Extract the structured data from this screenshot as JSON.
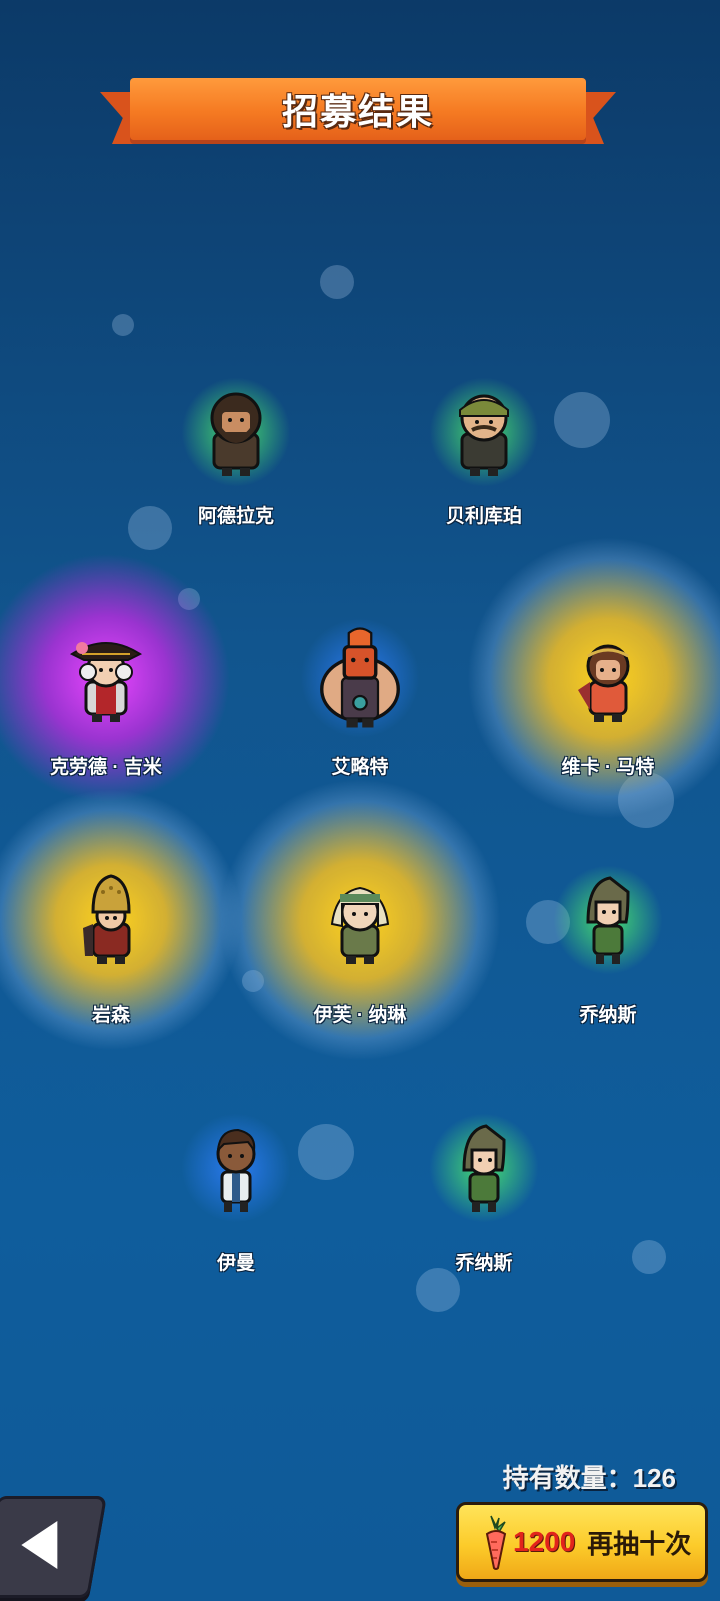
{
  "header": {
    "title": "招募结果"
  },
  "heroes": [
    {
      "name": "阿德拉克",
      "rarity_color": "#55ff66"
    },
    {
      "name": "贝利库珀",
      "rarity_color": "#55ff66"
    },
    {
      "name": "克劳德 · 吉米",
      "rarity_color": "#e040ff"
    },
    {
      "name": "艾略特",
      "rarity_color": "#2f80ff"
    },
    {
      "name": "维卡 · 马特",
      "rarity_color": "#ffc81e"
    },
    {
      "name": "岩森",
      "rarity_color": "#ffc81e"
    },
    {
      "name": "伊芙 · 纳琳",
      "rarity_color": "#ffc81e"
    },
    {
      "name": "乔纳斯",
      "rarity_color": "#55ff66"
    },
    {
      "name": "伊曼",
      "rarity_color": "#2f80ff"
    },
    {
      "name": "乔纳斯",
      "rarity_color": "#55ff66"
    }
  ],
  "footer": {
    "holding_label": "持有数量：",
    "holding_count": "126",
    "redraw_cost": "1200",
    "redraw_label": "再抽十次",
    "back_icon": "back-arrow-icon",
    "cost_icon": "carrot-icon"
  }
}
